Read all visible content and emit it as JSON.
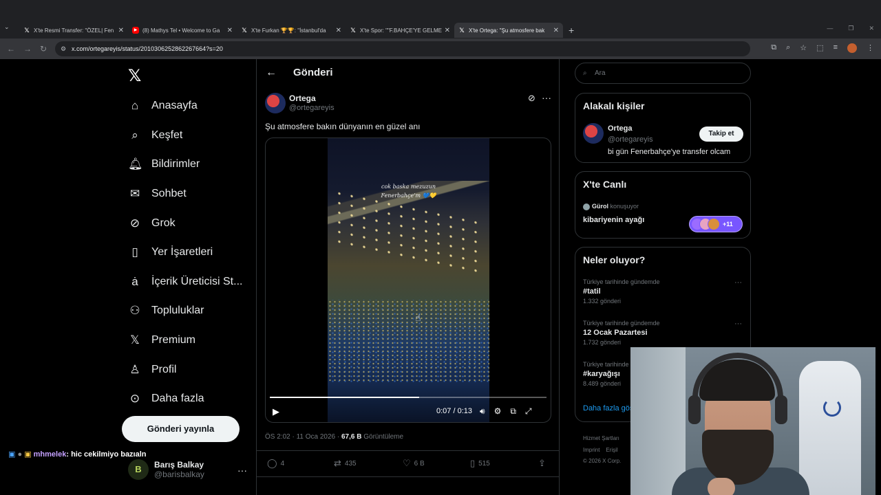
{
  "browser": {
    "tabs": [
      {
        "label": "X'te Resmi Transfer: \"ÖZEL| Fen",
        "icon": "x-logo"
      },
      {
        "label": "(8) Mathys Tel • Welcome to Ga",
        "icon": "youtube-logo"
      },
      {
        "label": "X'te Furkan 🏆🏆: \"İstanbul'da",
        "icon": "x-logo"
      },
      {
        "label": "X'te Spor: \"\"F.BAHÇE'YE GELMEY",
        "icon": "x-logo"
      },
      {
        "label": "X'te Ortega: \"Şu atmosfere bak",
        "icon": "x-logo",
        "active": true
      }
    ],
    "new_tab": "+",
    "url": "x.com/ortegareyis/status/2010306252862267664?s=20"
  },
  "nav": {
    "items": [
      {
        "label": "Anasayfa",
        "icon": "home-icon"
      },
      {
        "label": "Keşfet",
        "icon": "search-icon"
      },
      {
        "label": "Bildirimler",
        "icon": "bell-icon"
      },
      {
        "label": "Sohbet",
        "icon": "mail-icon"
      },
      {
        "label": "Grok",
        "icon": "grok-icon"
      },
      {
        "label": "Yer İşaretleri",
        "icon": "bookmark-icon"
      },
      {
        "label": "İçerik Üreticisi St...",
        "icon": "creator-icon"
      },
      {
        "label": "Topluluklar",
        "icon": "communities-icon"
      },
      {
        "label": "Premium",
        "icon": "x-icon"
      },
      {
        "label": "Profil",
        "icon": "person-icon"
      },
      {
        "label": "Daha fazla",
        "icon": "more-circle-icon"
      }
    ],
    "post_button": "Gönderi yayınla",
    "account": {
      "name": "Barış Balkay",
      "handle": "@barisbalkay",
      "avatar_text": "B"
    }
  },
  "chat_overlay": {
    "user": "mhmelek",
    "message": ": hic cekilmiyo bazıaln"
  },
  "post": {
    "page_title": "Gönderi",
    "author_name": "Ortega",
    "author_handle": "@ortegareyis",
    "text": "Şu atmosfere bakın dünyanın en güzel anı",
    "video_caption_line1": "cok baska mezuzun",
    "video_caption_line2": "Fenerbahçe'm 💙💛",
    "video_time": "0:07 / 0:13",
    "progress": 0.54,
    "timestamp": "ÖS 2:02 · 11 Oca 2026 · ",
    "views_value": "67,6 B",
    "views_label": " Görüntüleme",
    "replies": "4",
    "reposts": "435",
    "likes": "6 B",
    "bookmarks": "515"
  },
  "sidebar": {
    "search_placeholder": "Ara",
    "relevant_title": "Alakalı kişiler",
    "relevant_person": {
      "name": "Ortega",
      "handle": "@ortegareyis",
      "bio": "bi gün Fenerbahçe'ye transfer olcam",
      "follow": "Takip et"
    },
    "live_title": "X'te Canlı",
    "live_user": "Gürol",
    "live_status": " konuşuyor",
    "live_topic": "kibariyenin ayağı",
    "live_count": "+11",
    "trends_title": "Neler oluyor?",
    "trends": [
      {
        "context": "Türkiye tarihinde gündemde",
        "name": "#tatil",
        "count": "1.332 gönderi"
      },
      {
        "context": "Türkiye tarihinde gündemde",
        "name": "12 Ocak Pazartesi",
        "count": "1.732 gönderi"
      },
      {
        "context": "Türkiye tarihinde gündemde",
        "name": "#karyağışı",
        "count": "8.489 gönderi"
      }
    ],
    "show_more": "Daha fazla göster",
    "footer": [
      "Hizmet Şartları",
      "Imprint",
      "© 2026 X Corp."
    ],
    "footer_extra": "Erişil"
  },
  "colors": {
    "accent": "#1d9bf0",
    "live": "#7856ff",
    "background": "#000000"
  }
}
